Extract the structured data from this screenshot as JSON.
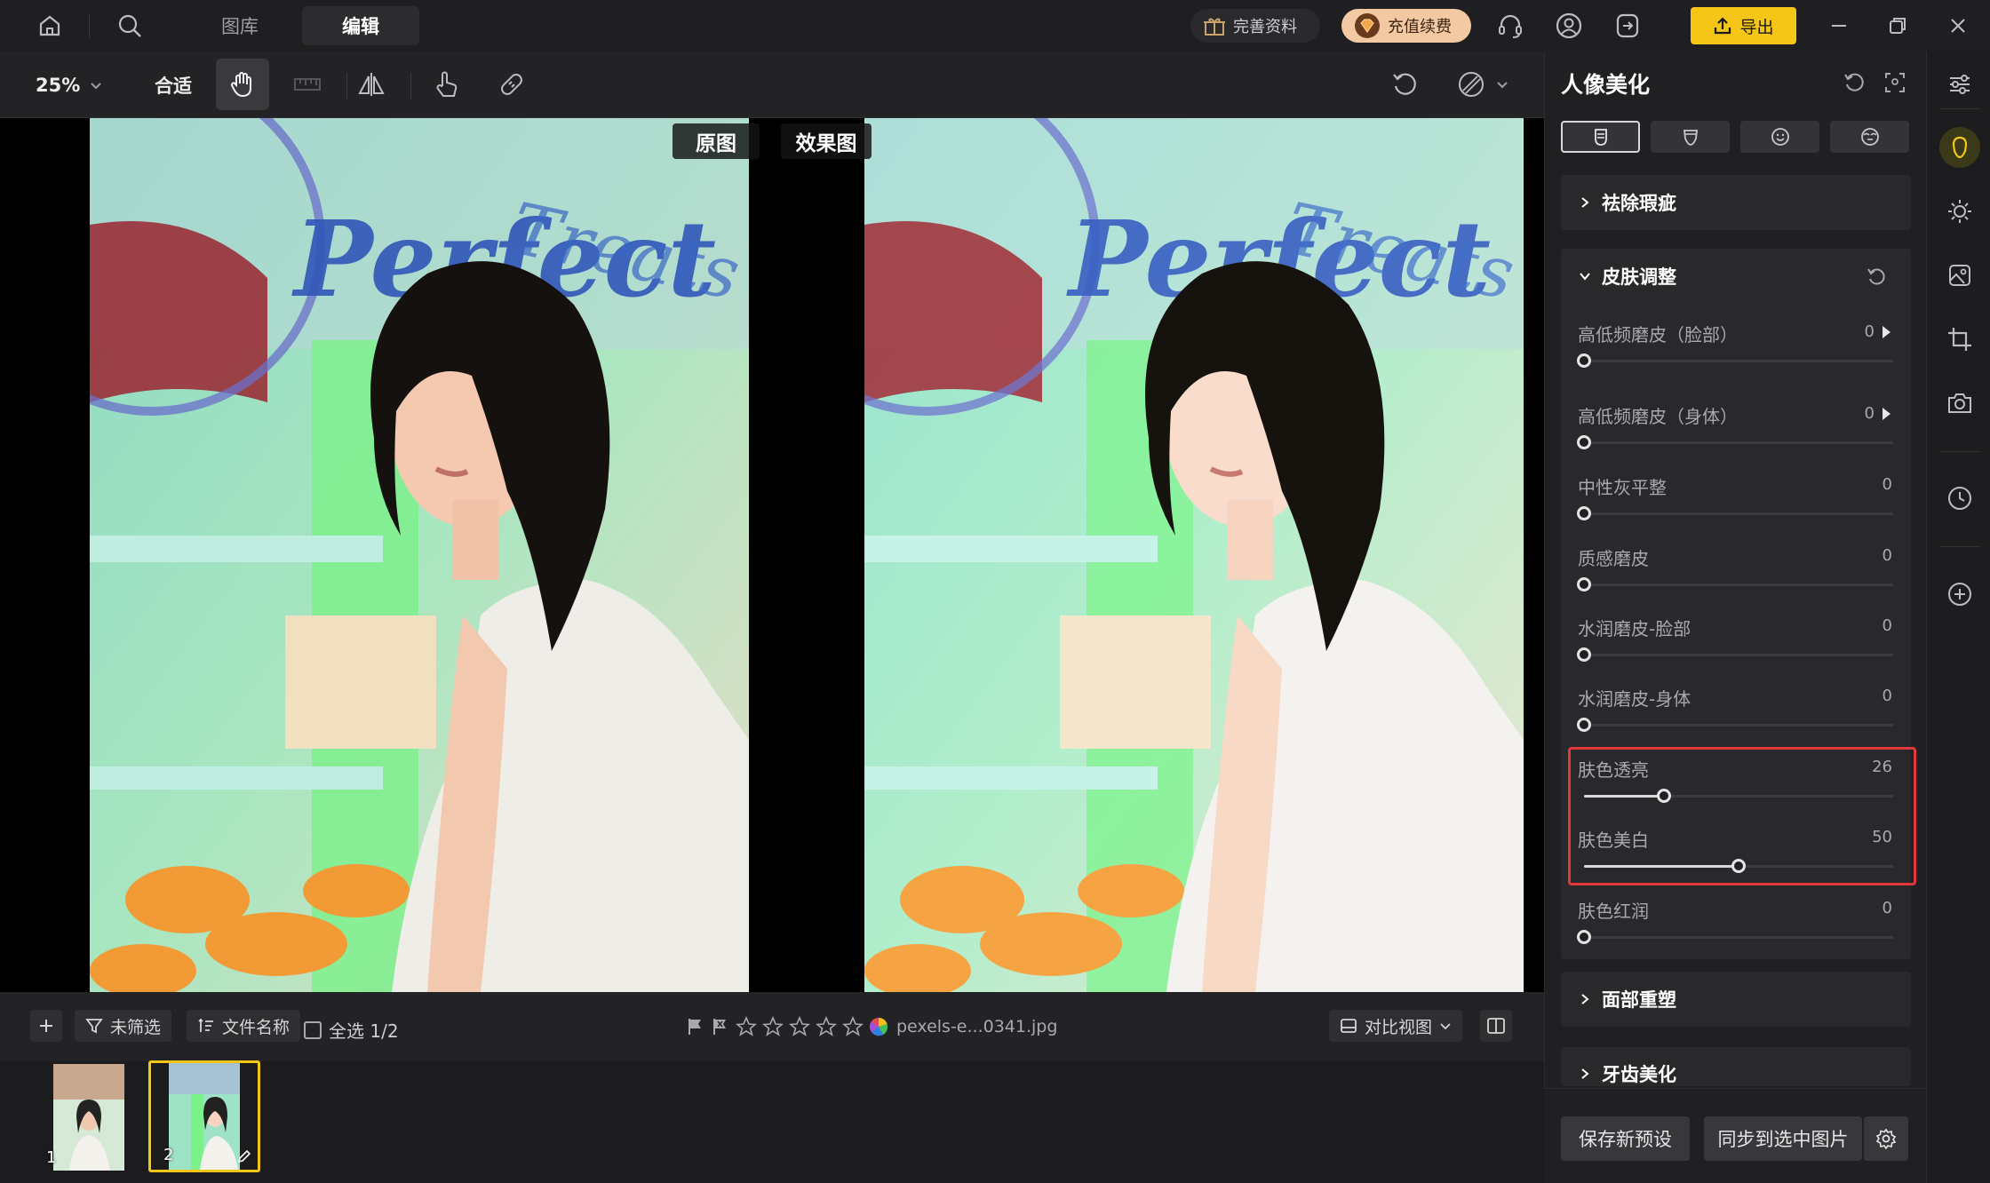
{
  "nav": {
    "tabs": [
      {
        "label": "图库"
      },
      {
        "label": "编辑"
      }
    ]
  },
  "header": {
    "profile_label": "完善资料",
    "vip_label": "充值续费",
    "export_label": "导出"
  },
  "toolbar": {
    "zoom": "25%",
    "fit": "合适"
  },
  "canvas": {
    "before_label": "原图",
    "after_label": "效果图"
  },
  "filmbar": {
    "filter_label": "未筛选",
    "sort_label": "文件名称",
    "select_all_label": "全选 1/2",
    "filename": "pexels-e...0341.jpg",
    "compare_label": "对比视图"
  },
  "thumbnails": [
    {
      "num": "1"
    },
    {
      "num": "2"
    }
  ],
  "panel": {
    "title": "人像美化",
    "sections": {
      "blemish": "祛除瑕疵",
      "skin": "皮肤调整",
      "face": "面部重塑",
      "teeth": "牙齿美化"
    },
    "sliders": [
      {
        "label": "高低频磨皮（脸部）",
        "value": "0"
      },
      {
        "label": "高低频磨皮（身体）",
        "value": "0"
      },
      {
        "label": "中性灰平整",
        "value": "0"
      },
      {
        "label": "质感磨皮",
        "value": "0"
      },
      {
        "label": "水润磨皮-脸部",
        "value": "0"
      },
      {
        "label": "水润磨皮-身体",
        "value": "0"
      },
      {
        "label": "肤色透亮",
        "value": "26"
      },
      {
        "label": "肤色美白",
        "value": "50"
      },
      {
        "label": "肤色红润",
        "value": "0"
      }
    ],
    "save_preset": "保存新预设",
    "sync_label": "同步到选中图片"
  },
  "colors": {
    "accent": "#f5c518",
    "highlight": "#e0383b",
    "vip": "#f3c9a4"
  }
}
